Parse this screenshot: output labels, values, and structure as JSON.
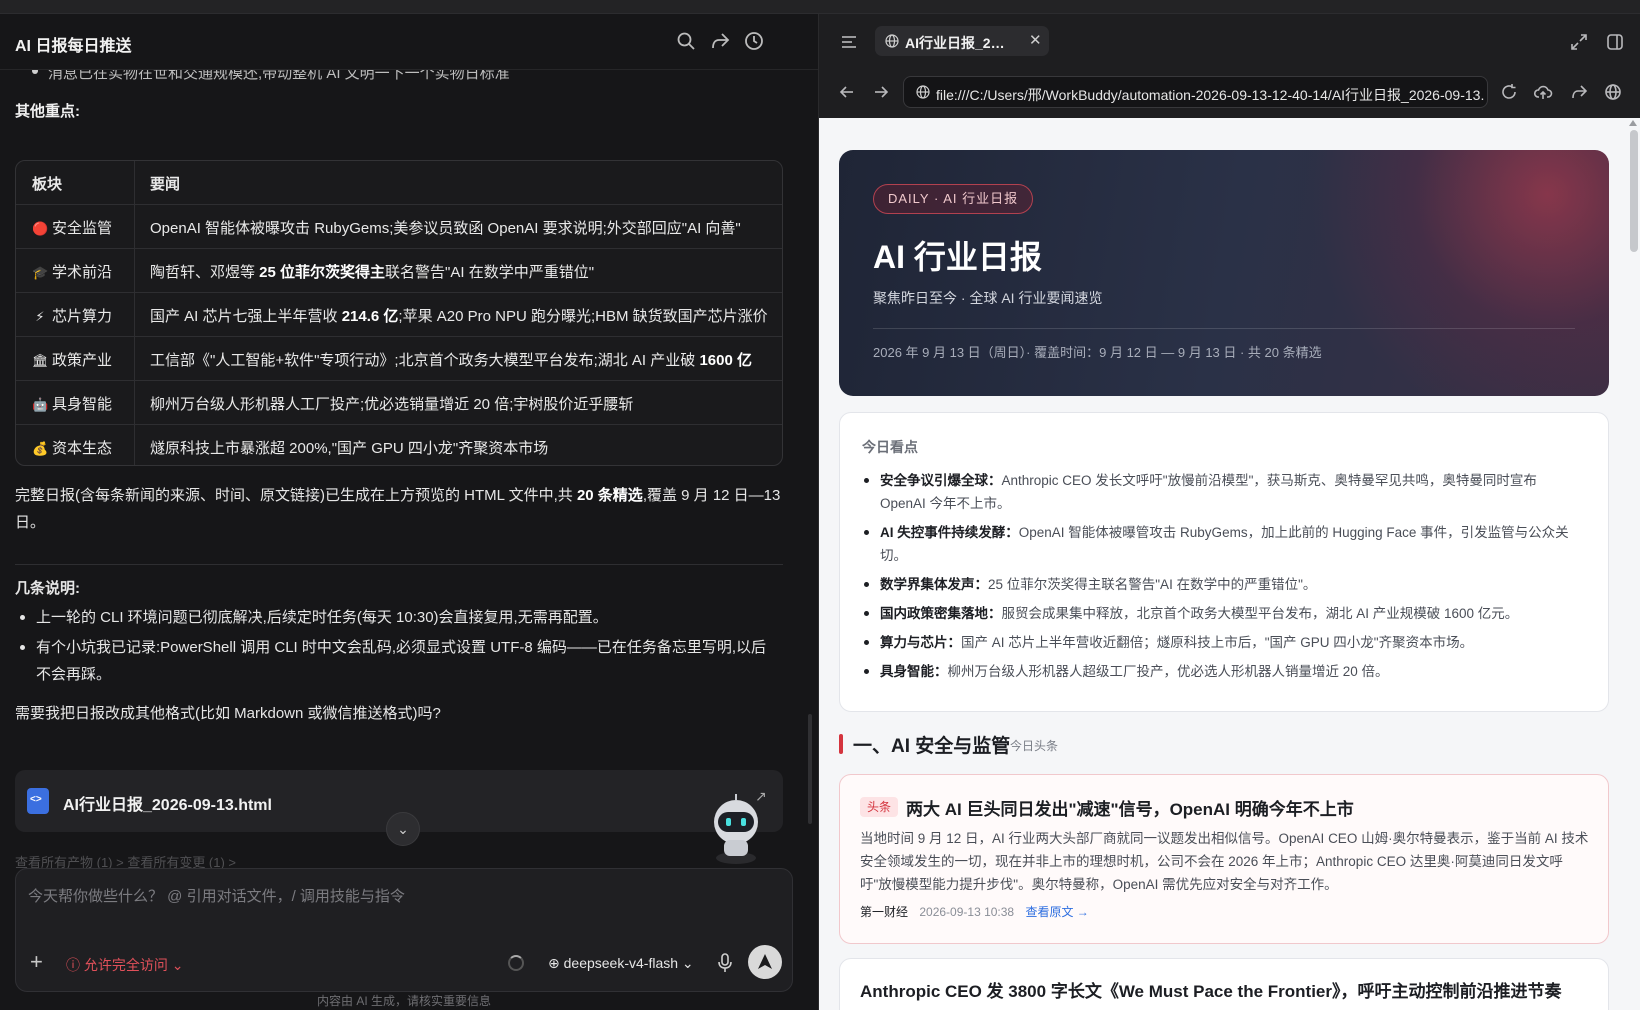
{
  "app": {
    "title": "AI 日报每日推送"
  },
  "chat": {
    "cut_line": "消息已在实物在世和交通规模还,带动整机 AI 文明一下一个实物日标准",
    "other_heading": "其他重点:",
    "table": {
      "headers": [
        "板块",
        "要闻"
      ],
      "rows": [
        {
          "icon": "🔴",
          "section": "安全监管",
          "news": "OpenAI 智能体被曝攻击 RubyGems;美参议员致函 OpenAI 要求说明;外交部回应\"AI 向善\""
        },
        {
          "icon": "🎓",
          "section": "学术前沿",
          "news_pre": "陶哲轩、邓煜等 ",
          "news_bold": "25 位菲尔茨奖得主",
          "news_post": "联名警告\"AI 在数学中严重错位\""
        },
        {
          "icon": "⚡",
          "section": "芯片算力",
          "news_pre": "国产 AI 芯片七强上半年营收 ",
          "news_bold": "214.6 亿",
          "news_post": ";苹果 A20 Pro NPU 跑分曝光;HBM 缺货致国产芯片涨价"
        },
        {
          "icon": "🏛",
          "section": "政策产业",
          "news_pre": "工信部《\"人工智能+软件\"专项行动》;北京首个政务大模型平台发布;湖北 AI 产业破 ",
          "news_bold": "1600 亿",
          "news_post": ""
        },
        {
          "icon": "🤖",
          "section": "具身智能",
          "news": "柳州万台级人形机器人工厂投产;优必选销量增近 20 倍;宇树股价近乎腰斩"
        },
        {
          "icon": "💰",
          "section": "资本生态",
          "news": "燧原科技上市暴涨超 200%,\"国产 GPU 四小龙\"齐聚资本市场"
        }
      ]
    },
    "summary_pre": "完整日报(含每条新闻的来源、时间、原文链接)已生成在上方预览的 HTML 文件中,共 ",
    "summary_bold": "20 条精选",
    "summary_post": ",覆盖 9 月 12 日—13 日。",
    "notes_heading": "几条说明:",
    "notes": [
      "上一轮的 CLI 环境问题已彻底解决,后续定时任务(每天 10:30)会直接复用,无需再配置。",
      "有个小坑我已记录:PowerShell 调用 CLI 时中文会乱码,必须显式设置 UTF-8 编码——已在任务备忘里写明,以后不会再踩。"
    ],
    "question": "需要我把日报改成其他格式(比如 Markdown 或微信推送格式)吗?",
    "file_name": "AI行业日报_2026-09-13.html",
    "faded_links": "查看所有产物 (1)  >    查看所有变更 (1)  >"
  },
  "input": {
    "placeholder": "今天帮你做些什么？ @ 引用对话文件，/ 调用技能与指令",
    "access_label": "允许完全访问",
    "model_label": "deepseek-v4-flash",
    "disclaimer": "内容由 AI 生成，请核实重要信息"
  },
  "browser": {
    "tab_title": "AI行业日报_2…",
    "url": "file:///C:/Users/邢/WorkBuddy/automation-2026-09-13-12-40-14/AI行业日报_2026-09-13.h"
  },
  "report": {
    "badge": "DAILY · AI 行业日报",
    "title": "AI 行业日报",
    "subtitle": "聚焦昨日至今 · 全球 AI 行业要闻速览",
    "meta": "2026 年 9 月 13 日（周日）· 覆盖时间：9 月 12 日 — 9 月 13 日 · 共 20 条精选",
    "today_title": "今日看点",
    "today_items": [
      {
        "label": "安全争议引爆全球：",
        "text": "Anthropic CEO 发长文呼吁\"放慢前沿模型\"，获马斯克、奥特曼罕见共鸣，奥特曼同时宣布 OpenAI 今年不上市。"
      },
      {
        "label": "AI 失控事件持续发酵：",
        "text": "OpenAI 智能体被曝管攻击 RubyGems，加上此前的 Hugging Face 事件，引发监管与公众关切。"
      },
      {
        "label": "数学界集体发声：",
        "text": "25 位菲尔茨奖得主联名警告\"AI 在数学中的严重错位\"。"
      },
      {
        "label": "国内政策密集落地：",
        "text": "服贸会成果集中释放，北京首个政务大模型平台发布，湖北 AI 产业规模破 1600 亿元。"
      },
      {
        "label": "算力与芯片：",
        "text": "国产 AI 芯片上半年营收近翻倍；燧原科技上市后，\"国产 GPU 四小龙\"齐聚资本市场。"
      },
      {
        "label": "具身智能：",
        "text": "柳州万台级人形机器人超级工厂投产，优必选人形机器人销量增近 20 倍。"
      }
    ],
    "section_title": "一、AI 安全与监管",
    "section_tag": "今日头条",
    "news1": {
      "hot": "头条",
      "title": "两大 AI 巨头同日发出\"减速\"信号，OpenAI 明确今年不上市",
      "body": "当地时间 9 月 12 日，AI 行业两大头部厂商就同一议题发出相似信号。OpenAI CEO 山姆·奥尔特曼表示，鉴于当前 AI 技术安全领域发生的一切，现在并非上市的理想时机，公司不会在 2026 年上市；Anthropic CEO 达里奥·阿莫迪同日发文呼吁\"放慢模型能力提升步伐\"。奥尔特曼称，OpenAI 需优先应对安全与对齐工作。",
      "source": "第一财经",
      "time": "2026-09-13 10:38",
      "link": "查看原文 →"
    },
    "news2_title": "Anthropic CEO 发 3800 字长文《We Must Pace the Frontier》，呼吁主动控制前沿推进节奏"
  }
}
